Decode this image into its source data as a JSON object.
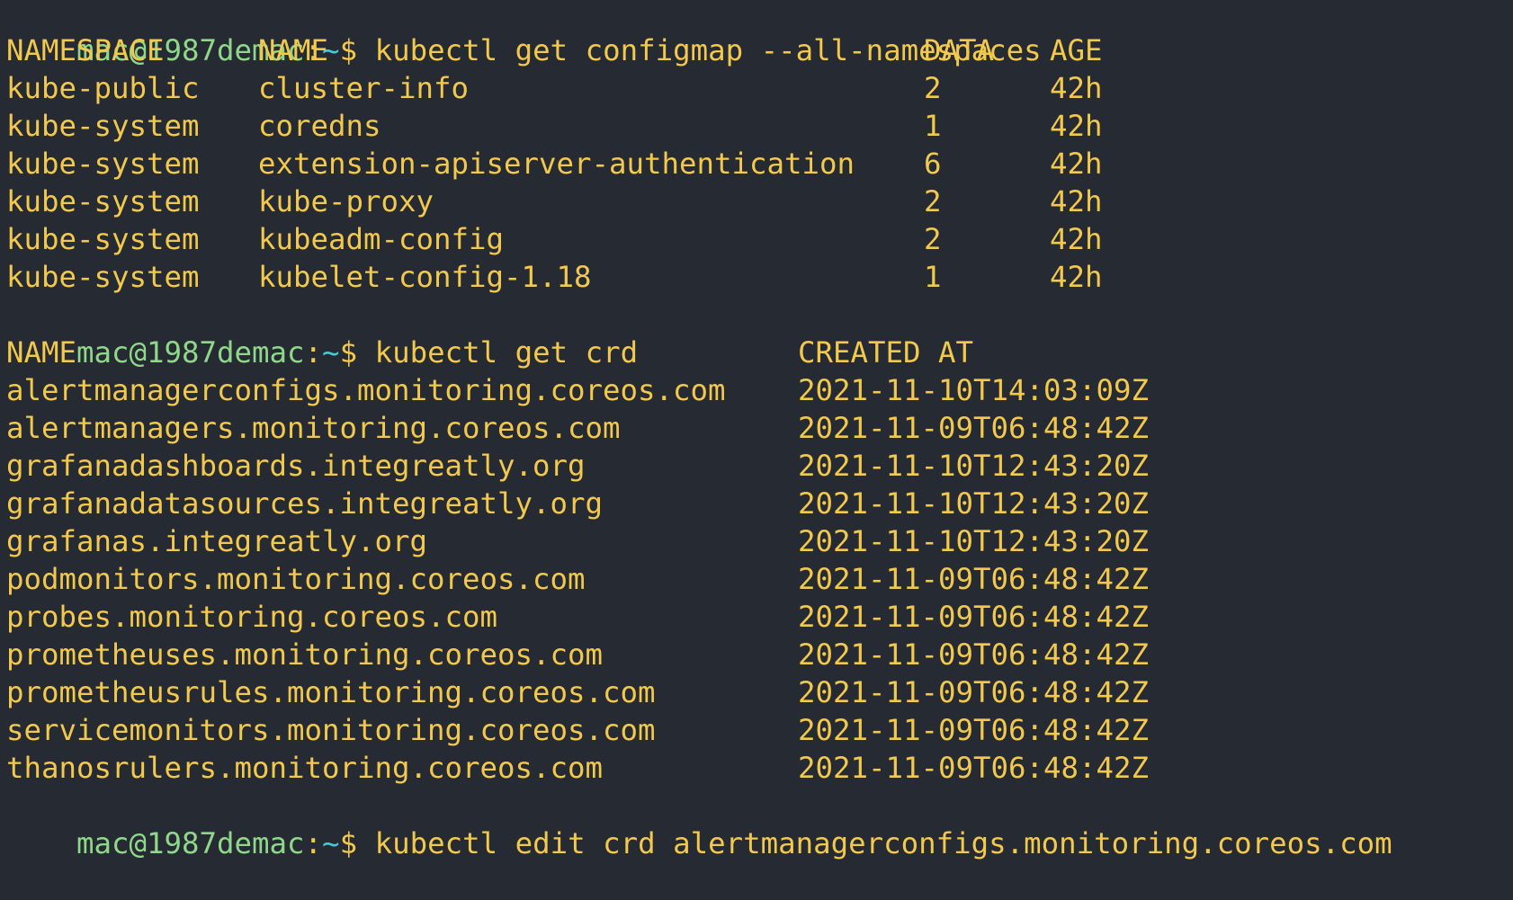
{
  "prompt": {
    "user_host": "mac@1987demac",
    "path_sep": ":",
    "path": "~",
    "sigil": "$"
  },
  "commands": [
    "kubectl get configmap --all-namespaces",
    "kubectl get crd",
    "kubectl edit crd alertmanagerconfigs.monitoring.coreos.com"
  ],
  "configmap_table": {
    "headers": [
      "NAMESPACE",
      "NAME",
      "DATA",
      "AGE"
    ],
    "rows": [
      [
        "kube-public",
        "cluster-info",
        "2",
        "42h"
      ],
      [
        "kube-system",
        "coredns",
        "1",
        "42h"
      ],
      [
        "kube-system",
        "extension-apiserver-authentication",
        "6",
        "42h"
      ],
      [
        "kube-system",
        "kube-proxy",
        "2",
        "42h"
      ],
      [
        "kube-system",
        "kubeadm-config",
        "2",
        "42h"
      ],
      [
        "kube-system",
        "kubelet-config-1.18",
        "1",
        "42h"
      ]
    ]
  },
  "crd_table": {
    "headers": [
      "NAME",
      "CREATED AT"
    ],
    "rows": [
      [
        "alertmanagerconfigs.monitoring.coreos.com",
        "2021-11-10T14:03:09Z"
      ],
      [
        "alertmanagers.monitoring.coreos.com",
        "2021-11-09T06:48:42Z"
      ],
      [
        "grafanadashboards.integreatly.org",
        "2021-11-10T12:43:20Z"
      ],
      [
        "grafanadatasources.integreatly.org",
        "2021-11-10T12:43:20Z"
      ],
      [
        "grafanas.integreatly.org",
        "2021-11-10T12:43:20Z"
      ],
      [
        "podmonitors.monitoring.coreos.com",
        "2021-11-09T06:48:42Z"
      ],
      [
        "probes.monitoring.coreos.com",
        "2021-11-09T06:48:42Z"
      ],
      [
        "prometheuses.monitoring.coreos.com",
        "2021-11-09T06:48:42Z"
      ],
      [
        "prometheusrules.monitoring.coreos.com",
        "2021-11-09T06:48:42Z"
      ],
      [
        "servicemonitors.monitoring.coreos.com",
        "2021-11-09T06:48:42Z"
      ],
      [
        "thanosrulers.monitoring.coreos.com",
        "2021-11-09T06:48:42Z"
      ]
    ]
  },
  "colors": {
    "background": "#262a33",
    "output_text": "#f2c94c",
    "prompt_user": "#8fd88a",
    "prompt_path": "#49c9d6"
  }
}
